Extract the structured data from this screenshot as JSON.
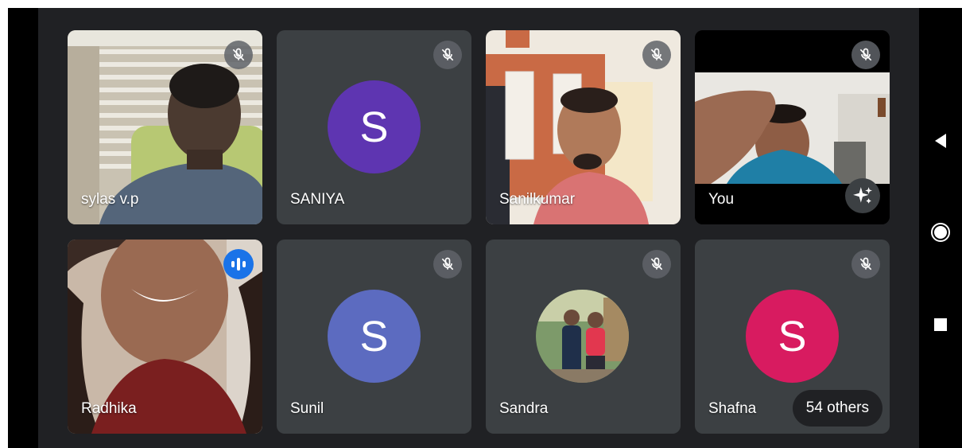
{
  "participants": [
    {
      "name": "sylas v.p",
      "kind": "video",
      "muted": true
    },
    {
      "name": "SANIYA",
      "kind": "avatar",
      "initial": "S",
      "color": "#5e35b1",
      "muted": true
    },
    {
      "name": "Sanilkumar",
      "kind": "video",
      "muted": true
    },
    {
      "name": "You",
      "kind": "video",
      "muted": true
    },
    {
      "name": "Radhika",
      "kind": "video",
      "speaking": true
    },
    {
      "name": "Sunil",
      "kind": "avatar",
      "initial": "S",
      "color": "#5c6bc0",
      "muted": true
    },
    {
      "name": "Sandra",
      "kind": "photo",
      "muted": true
    },
    {
      "name": "Shafna",
      "kind": "avatar",
      "initial": "S",
      "color": "#d81b60",
      "muted": true
    }
  ],
  "others_label": "54 others",
  "icons": {
    "muted": "mic-off-icon",
    "speaking": "audio-level-icon",
    "effects": "sparkle-icon",
    "nav_back": "back-icon",
    "nav_home": "home-icon",
    "nav_recent": "recents-icon"
  }
}
